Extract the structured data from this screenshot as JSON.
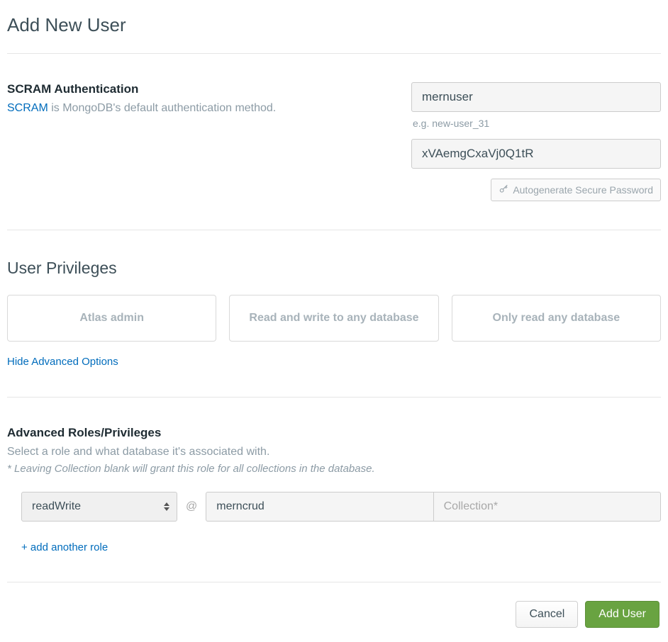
{
  "page_title": "Add New User",
  "auth": {
    "title": "SCRAM Authentication",
    "scram_link_text": "SCRAM",
    "description_rest": " is MongoDB's default authentication method.",
    "username_value": "mernuser",
    "username_helper": "e.g. new-user_31",
    "password_value": "xVAemgCxaVj0Q1tR",
    "autogen_label": "Autogenerate Secure Password"
  },
  "privileges": {
    "title": "User Privileges",
    "cards": [
      "Atlas admin",
      "Read and write to any database",
      "Only read any database"
    ],
    "hide_advanced_label": "Hide Advanced Options"
  },
  "advanced": {
    "title": "Advanced Roles/Privileges",
    "description": "Select a role and what database it's associated with.",
    "note": "* Leaving Collection blank will grant this role for all collections in the database.",
    "role_selected": "readWrite",
    "at": "@",
    "database_value": "merncrud",
    "collection_placeholder": "Collection*",
    "add_another_label": "+ add another role"
  },
  "footer": {
    "cancel": "Cancel",
    "submit": "Add User"
  }
}
